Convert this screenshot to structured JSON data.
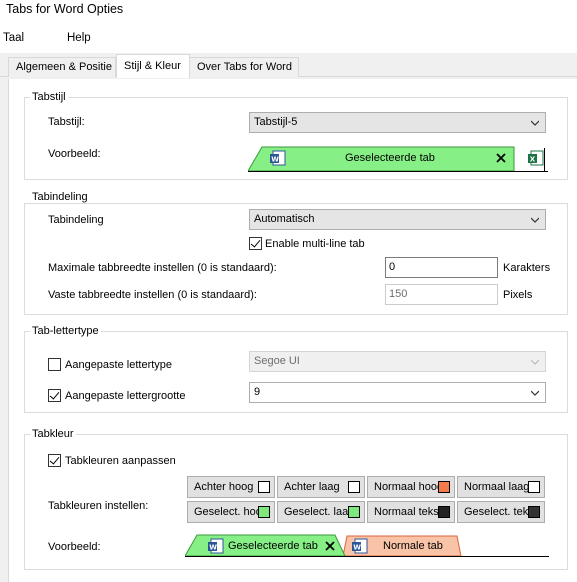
{
  "window": {
    "title": "Tabs for Word Opties"
  },
  "menu": {
    "language": "Taal",
    "help": "Help"
  },
  "tabs": [
    {
      "label": "Algemeen & Positie"
    },
    {
      "label": "Stijl & Kleur"
    },
    {
      "label": "Over Tabs for Word"
    }
  ],
  "tabstyle": {
    "group_title": "Tabstijl",
    "style_label": "Tabstijl:",
    "style_value": "Tabstijl-5",
    "preview_label": "Voorbeeld:",
    "preview_tab_label": "Geselecteerde tab"
  },
  "layout": {
    "group_title": "Tabindeling",
    "layout_label": "Tabindeling",
    "layout_value": "Automatisch",
    "multiline_label": "Enable multi-line tab",
    "multiline_checked": true,
    "max_width_label": "Maximale tabbreedte instellen (0 is standaard):",
    "max_width_value": "0",
    "max_width_unit": "Karakters",
    "fixed_width_label": "Vaste tabbreedte instellen (0 is standaard):",
    "fixed_width_value": "150",
    "fixed_width_unit": "Pixels"
  },
  "font": {
    "group_title": "Tab-lettertype",
    "custom_font_label": "Aangepaste lettertype",
    "custom_font_checked": false,
    "font_value": "Segoe UI",
    "custom_size_label": "Aangepaste lettergrootte",
    "custom_size_checked": true,
    "size_value": "9"
  },
  "colors": {
    "group_title": "Tabkleur",
    "customize_label": "Tabkleuren aanpassen",
    "customize_checked": true,
    "set_label": "Tabkleuren instellen:",
    "buttons": [
      {
        "label": "Achter hoog",
        "color": "#ffffff"
      },
      {
        "label": "Achter laag",
        "color": "#ffffff"
      },
      {
        "label": "Normaal hoog",
        "color": "#f47b4c"
      },
      {
        "label": "Normaal laag",
        "color": "#ffffff"
      },
      {
        "label": "Geselect. hoog",
        "color": "#7ee87e"
      },
      {
        "label": "Geselect. laag",
        "color": "#7ee87e"
      },
      {
        "label": "Normaal tekst",
        "color": "#222222"
      },
      {
        "label": "Geselect. tekst",
        "color": "#333333"
      }
    ],
    "preview_label": "Voorbeeld:",
    "preview_selected_label": "Geselecteerde tab",
    "preview_normal_label": "Normale tab",
    "selected_tab_color": "#86f086",
    "normal_tab_color": "#f9c3a8"
  }
}
